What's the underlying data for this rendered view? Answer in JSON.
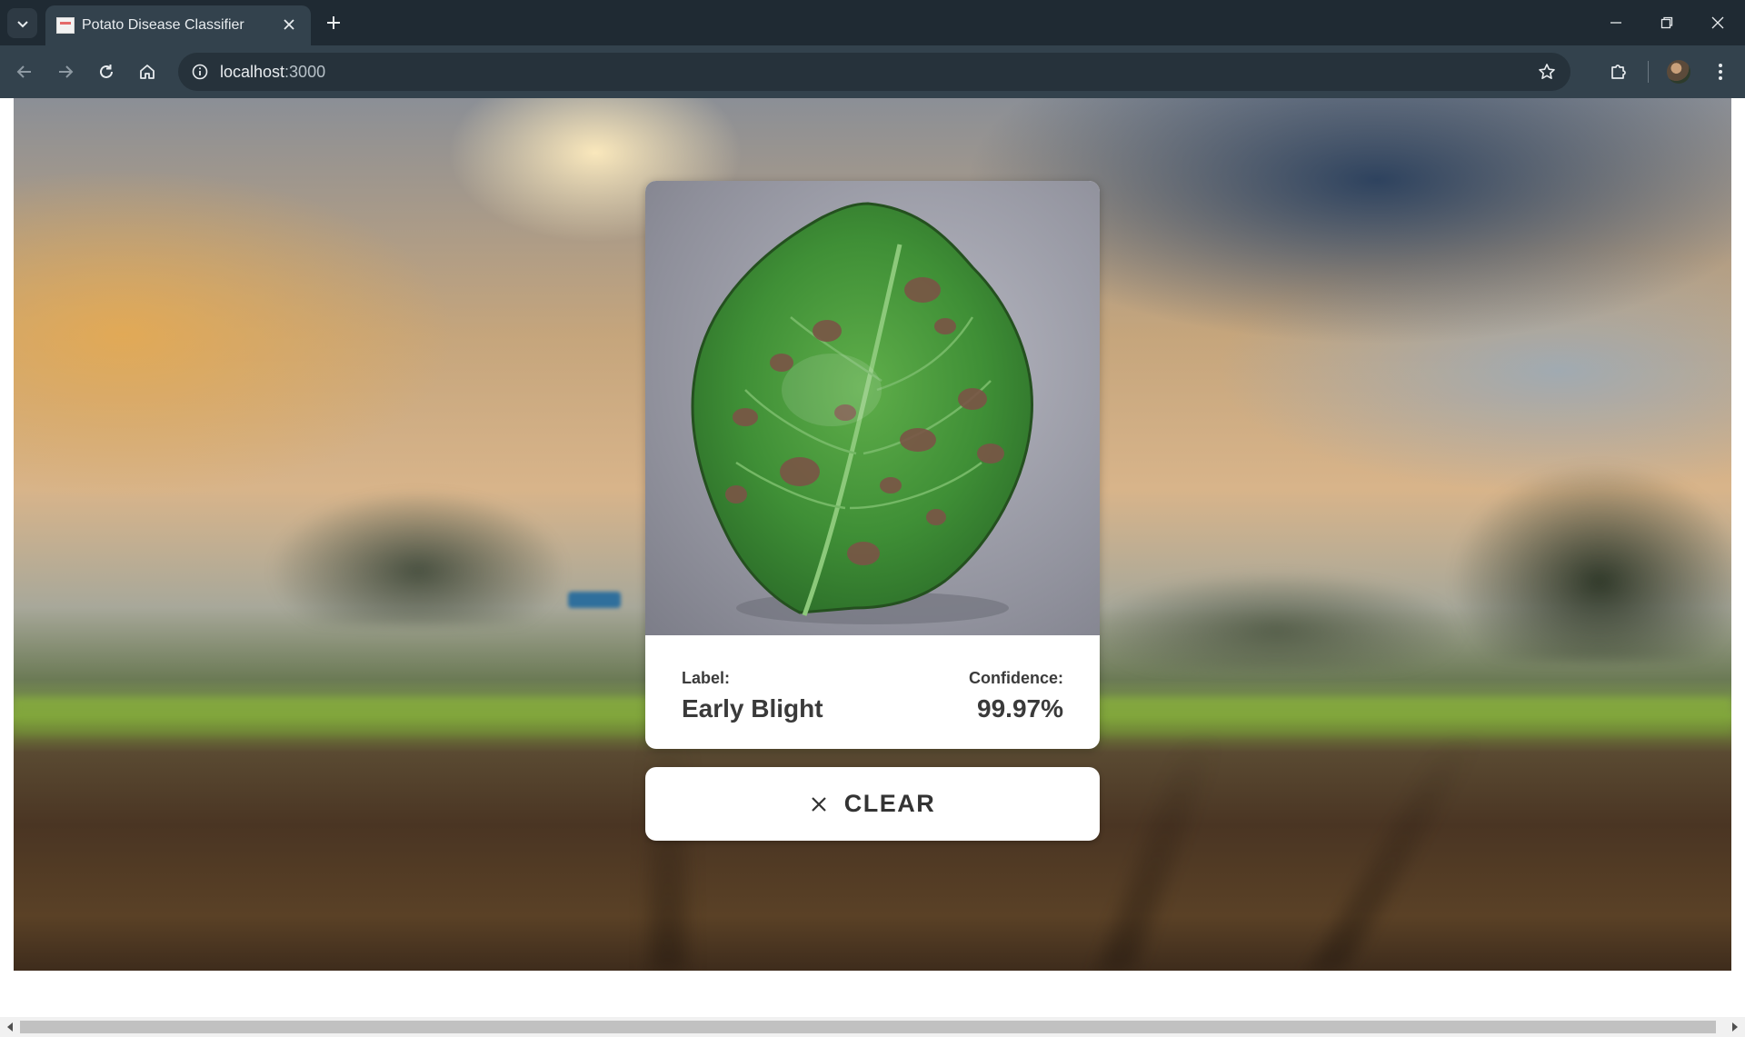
{
  "browser": {
    "tab_title": "Potato Disease Classifier",
    "url_host": "localhost",
    "url_port": ":3000"
  },
  "icons": {
    "tab_search": "chevron-down-icon",
    "tab_close": "close-icon",
    "new_tab": "plus-icon",
    "minimize": "minimize-icon",
    "restore": "restore-icon",
    "close_window": "close-icon",
    "back": "arrow-left-icon",
    "forward": "arrow-right-icon",
    "reload": "reload-icon",
    "home": "home-icon",
    "site_info": "info-icon",
    "bookmark": "star-icon",
    "extensions": "puzzle-icon",
    "menu": "kebab-menu-icon",
    "clear": "close-icon"
  },
  "result": {
    "label_caption": "Label:",
    "label_value": "Early Blight",
    "confidence_caption": "Confidence:",
    "confidence_value": "99.97%"
  },
  "actions": {
    "clear_label": "CLEAR"
  },
  "colors": {
    "chrome_dark": "#1f2a33",
    "chrome_toolbar": "#33424d",
    "card_bg": "#ffffff",
    "text_dark": "#3a3a3a"
  }
}
